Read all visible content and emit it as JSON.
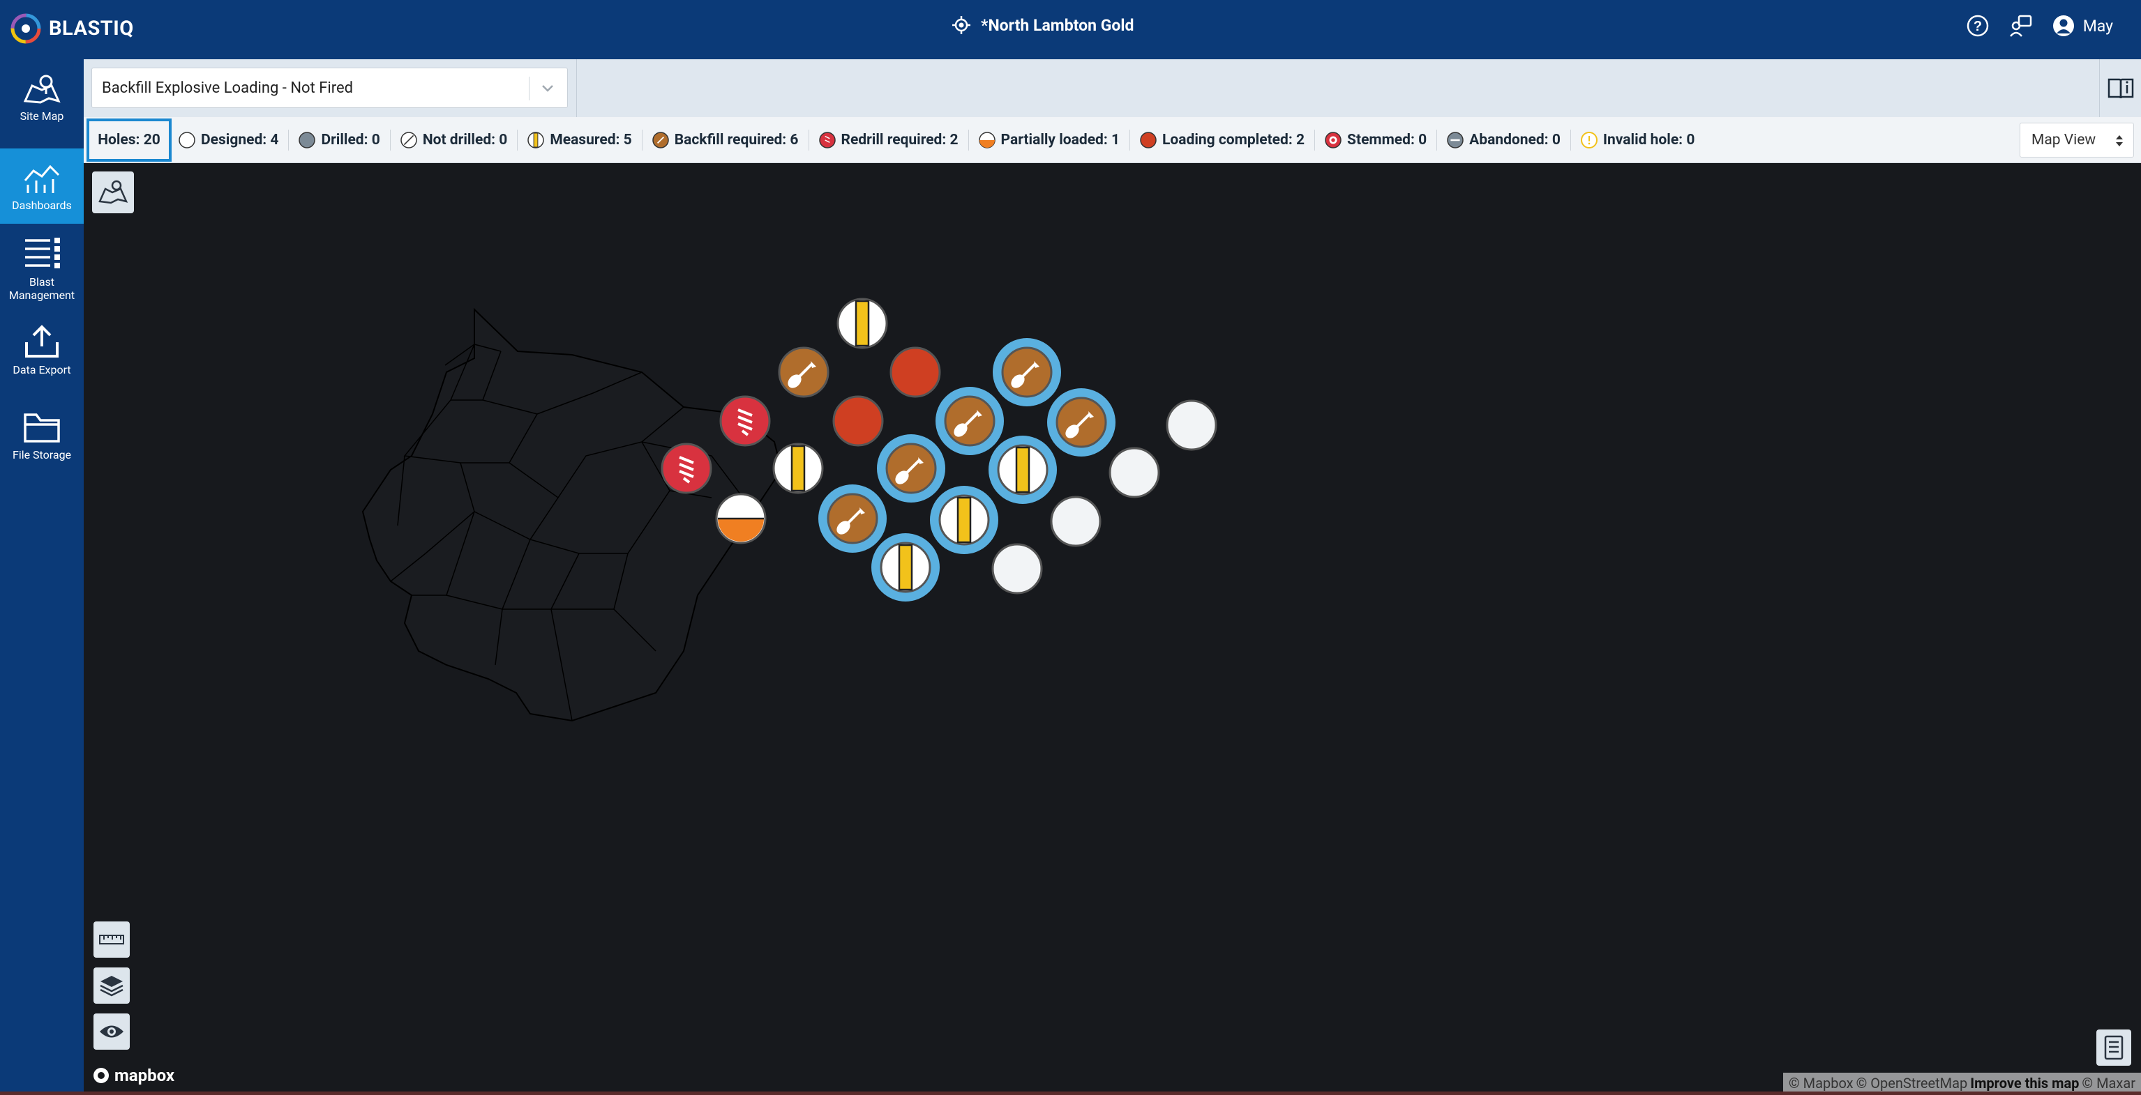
{
  "app": {
    "logo_text": "BLASTIQ",
    "site_title": "*North Lambton Gold",
    "user_name": "May"
  },
  "sidebar": {
    "items": [
      {
        "label": "Site Map",
        "icon": "map-icon",
        "active": false
      },
      {
        "label": "Dashboards",
        "icon": "dashboard-icon",
        "active": true
      },
      {
        "label": "Blast Management",
        "icon": "list-icon",
        "active": false
      },
      {
        "label": "Data Export",
        "icon": "upload-icon",
        "active": false
      },
      {
        "label": "File Storage",
        "icon": "folder-icon",
        "active": false
      }
    ]
  },
  "toolbar": {
    "view_value": "Backfill Explosive Loading - Not Fired"
  },
  "status": {
    "holes": "Holes: 20",
    "items": [
      {
        "label": "Designed: 4",
        "icon": "designed-icon"
      },
      {
        "label": "Drilled: 0",
        "icon": "drilled-icon"
      },
      {
        "label": "Not drilled: 0",
        "icon": "not-drilled-icon"
      },
      {
        "label": "Measured: 5",
        "icon": "measured-icon"
      },
      {
        "label": "Backfill required: 6",
        "icon": "backfill-icon"
      },
      {
        "label": "Redrill required: 2",
        "icon": "redrill-icon"
      },
      {
        "label": "Partially loaded: 1",
        "icon": "partially-loaded-icon"
      },
      {
        "label": "Loading completed: 2",
        "icon": "loading-completed-icon"
      },
      {
        "label": "Stemmed: 0",
        "icon": "stemmed-icon"
      },
      {
        "label": "Abandoned: 0",
        "icon": "abandoned-icon"
      },
      {
        "label": "Invalid hole: 0",
        "icon": "invalid-hole-icon"
      }
    ],
    "map_view_label": "Map View"
  },
  "map": {
    "attribution": {
      "mapbox": "© Mapbox",
      "osm": "© OpenStreetMap",
      "improve": "Improve this map",
      "maxar": "© Maxar"
    },
    "mapbox_logo": "mapbox",
    "holes": [
      {
        "status": "measured",
        "selected": false
      },
      {
        "status": "backfill",
        "selected": false
      },
      {
        "status": "loading-completed",
        "selected": false
      },
      {
        "status": "backfill",
        "selected": true
      },
      {
        "status": "redrill",
        "selected": false
      },
      {
        "status": "loading-completed",
        "selected": false
      },
      {
        "status": "backfill",
        "selected": true
      },
      {
        "status": "backfill",
        "selected": true
      },
      {
        "status": "designed",
        "selected": false
      },
      {
        "status": "redrill",
        "selected": false
      },
      {
        "status": "measured",
        "selected": false
      },
      {
        "status": "backfill",
        "selected": true
      },
      {
        "status": "measured",
        "selected": true
      },
      {
        "status": "designed",
        "selected": false
      },
      {
        "status": "partially-loaded",
        "selected": false
      },
      {
        "status": "backfill",
        "selected": true
      },
      {
        "status": "measured",
        "selected": true
      },
      {
        "status": "designed",
        "selected": false
      },
      {
        "status": "measured",
        "selected": true
      },
      {
        "status": "designed",
        "selected": false
      }
    ]
  },
  "colors": {
    "nav_bg": "#0b3a78",
    "nav_active": "#1690d8",
    "backfill": "#b06d2c",
    "loading": "#cf3f22",
    "redrill": "#d8323f",
    "measured_stripe": "#f2c21b",
    "partial": "#f07f22",
    "selection_ring": "#5ab0e0",
    "designed": "#f2f4f6"
  }
}
